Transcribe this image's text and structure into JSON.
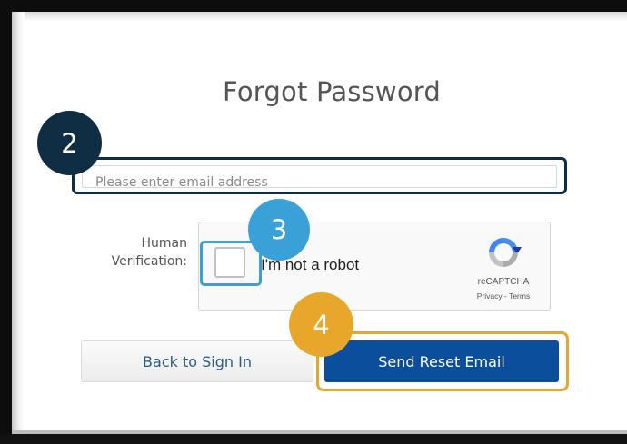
{
  "form": {
    "title": "Forgot Password",
    "email_placeholder": "Please enter email address",
    "human_verification_label": "Human Verification:",
    "back_button_label": "Back to Sign In",
    "send_button_label": "Send Reset Email"
  },
  "recaptcha": {
    "checkbox_label": "I'm not a robot",
    "brand": "reCAPTCHA",
    "links": "Privacy - Terms",
    "checked": false
  },
  "callouts": [
    {
      "number": "2",
      "color": "#0f2e44",
      "target": "email-field"
    },
    {
      "number": "3",
      "color": "#39a1d7",
      "target": "captcha-checkbox"
    },
    {
      "number": "4",
      "color": "#e8a72b",
      "target": "send-reset-email-button"
    }
  ],
  "colors": {
    "primary_button": "#0b4f9c",
    "link_text": "#2c5a86"
  }
}
